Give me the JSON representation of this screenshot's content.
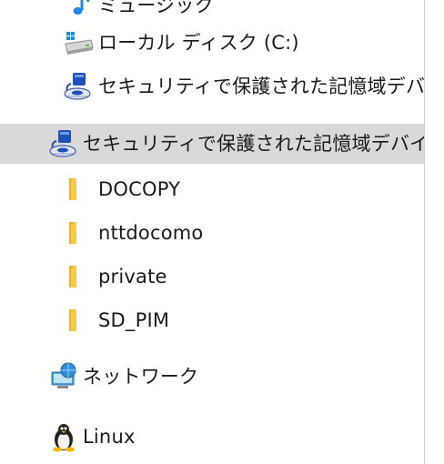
{
  "nav": {
    "items": [
      {
        "label": "ミュージック",
        "icon": "music-icon"
      },
      {
        "label": "ローカル ディスク (C:)",
        "icon": "drive-icon"
      },
      {
        "label": "セキュリティで保護された記憶域デバイス",
        "icon": "secure-storage-icon"
      },
      {
        "label": "セキュリティで保護された記憶域デバイス",
        "icon": "secure-storage-icon",
        "selected": true
      },
      {
        "label": "DOCOPY",
        "icon": "folder-icon"
      },
      {
        "label": "nttdocomo",
        "icon": "folder-icon"
      },
      {
        "label": "private",
        "icon": "folder-icon"
      },
      {
        "label": "SD_PIM",
        "icon": "folder-icon"
      },
      {
        "label": "ネットワーク",
        "icon": "network-icon"
      },
      {
        "label": "Linux",
        "icon": "linux-icon"
      }
    ]
  },
  "colors": {
    "selected_bg": "#d9d9d9",
    "folder": "#f6c94a",
    "music": "#1e88e5",
    "secure": "#1d4fb8"
  }
}
